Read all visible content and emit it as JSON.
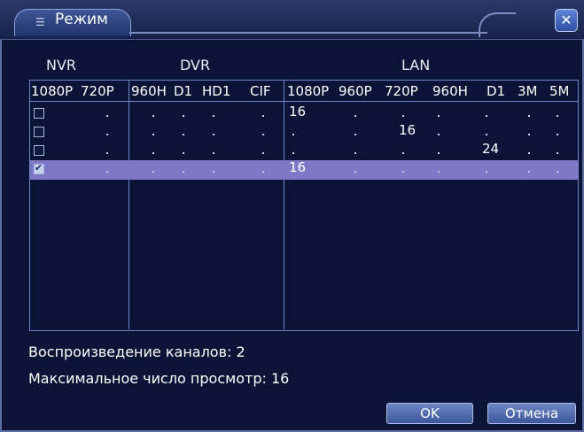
{
  "window": {
    "title": "Режим",
    "title_icon": "menu-lines-icon",
    "close_icon": "close-icon"
  },
  "groups": {
    "nvr": "NVR",
    "dvr": "DVR",
    "lan": "LAN"
  },
  "columns": [
    "1080P",
    "720P",
    "960H",
    "D1",
    "HD1",
    "CIF",
    "1080P",
    "960P",
    "720P",
    "960H",
    "D1",
    "3M",
    "5M"
  ],
  "rows": [
    {
      "checked": false,
      "selected": false,
      "values": [
        "",
        "",
        "",
        "",
        "",
        "",
        "16",
        "",
        "",
        "",
        "",
        "",
        ""
      ]
    },
    {
      "checked": false,
      "selected": false,
      "values": [
        "",
        "",
        "",
        "",
        "",
        "",
        "",
        "",
        "16",
        "",
        "",
        "",
        ""
      ]
    },
    {
      "checked": false,
      "selected": false,
      "values": [
        "",
        "",
        "",
        "",
        "",
        "",
        "",
        "",
        "",
        "",
        "24",
        "",
        ""
      ]
    },
    {
      "checked": true,
      "selected": true,
      "values": [
        "",
        "",
        "",
        "",
        "",
        "",
        "16",
        "",
        "",
        "",
        "",
        "",
        ""
      ]
    }
  ],
  "info": {
    "playback_label": "Воспроизведение каналов: 2",
    "max_view_label": "Максимальное число просмотр: 16"
  },
  "buttons": {
    "ok": "OK",
    "cancel": "Отмена"
  },
  "colors": {
    "background": "#0b1436",
    "selected_row": "#7e78c7",
    "border": "#6f86c8"
  }
}
